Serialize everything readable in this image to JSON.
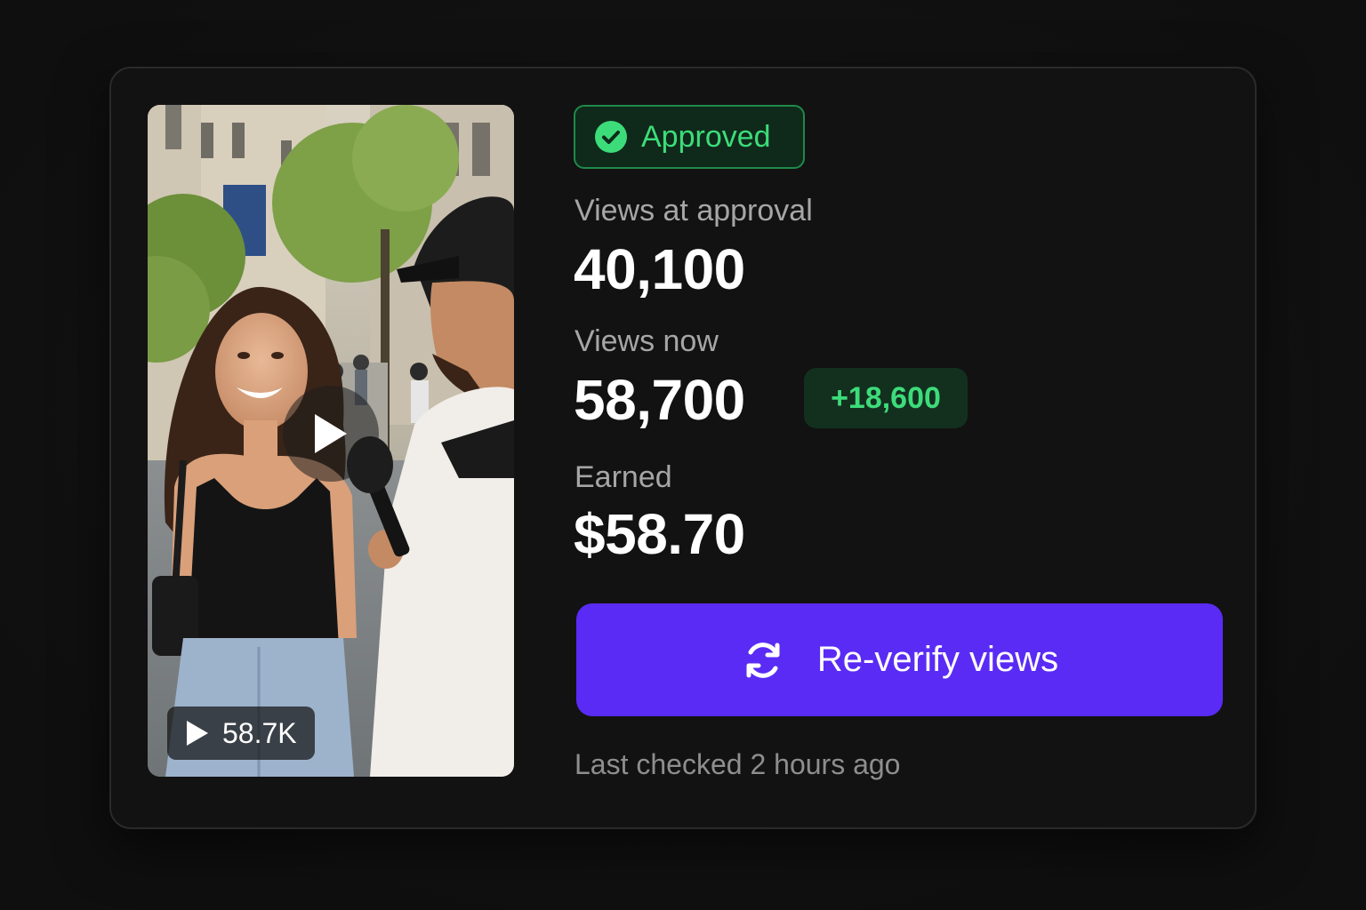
{
  "video": {
    "views_badge": "58.7K",
    "thumbnail_description_icon": "play-icon"
  },
  "status": {
    "label": "Approved",
    "icon": "check-circle-icon",
    "color": "#3ddc7a"
  },
  "metrics": {
    "views_at_approval_label": "Views at approval",
    "views_at_approval_value": "40,100",
    "views_now_label": "Views now",
    "views_now_value": "58,700",
    "views_delta": "+18,600",
    "earned_label": "Earned",
    "earned_value": "$58.70"
  },
  "action": {
    "reverify_label": "Re-verify views",
    "reverify_icon": "refresh-icon",
    "accent": "#5a2bf5"
  },
  "footer": {
    "last_checked": "Last checked 2 hours ago"
  }
}
